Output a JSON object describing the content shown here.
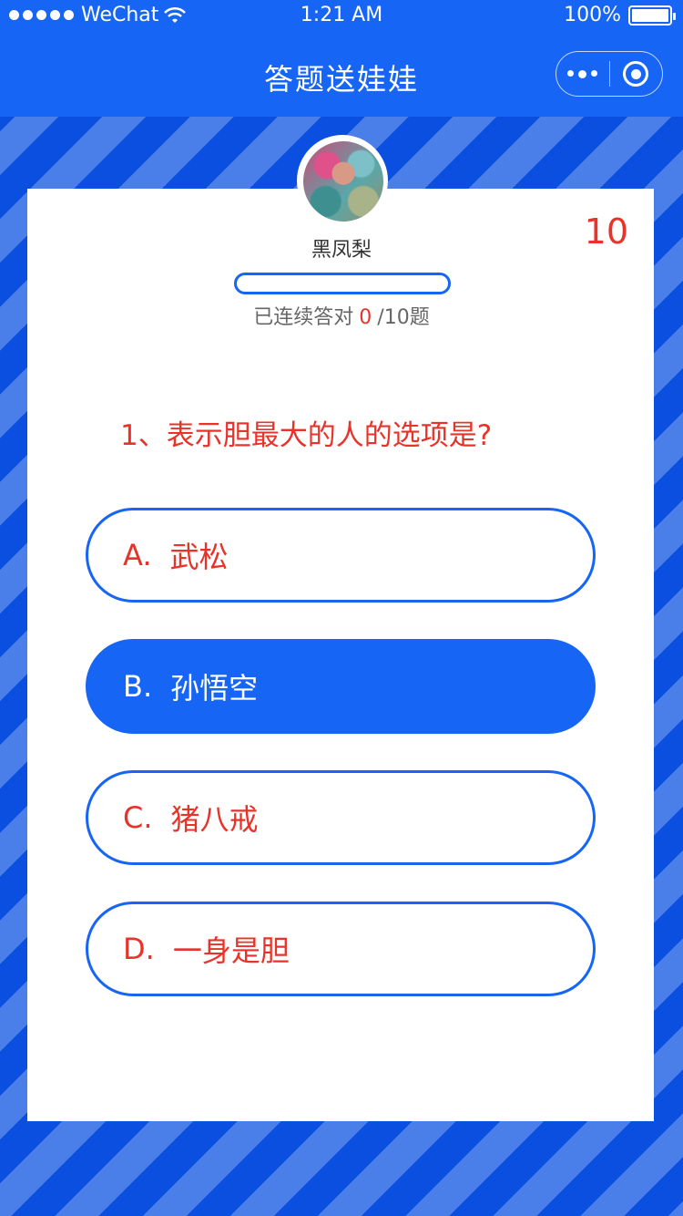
{
  "status_bar": {
    "carrier": "WeChat",
    "time": "1:21 AM",
    "battery": "100%"
  },
  "nav": {
    "title": "答题送娃娃",
    "more_icon": "more-dots-icon",
    "close_icon": "target-close-icon"
  },
  "user": {
    "name": "黑凤梨"
  },
  "timer": "10",
  "progress": {
    "label_before": "已连续答对",
    "correct": "0",
    "label_after": "/10题",
    "fraction": 0
  },
  "question": {
    "text": "1、表示胆最大的人的选项是?"
  },
  "options": [
    {
      "letter": "A.",
      "text": "武松",
      "selected": false
    },
    {
      "letter": "B.",
      "text": "孙悟空",
      "selected": true
    },
    {
      "letter": "C.",
      "text": "猪八戒",
      "selected": false
    },
    {
      "letter": "D.",
      "text": "一身是胆",
      "selected": false
    }
  ],
  "colors": {
    "primary": "#1665f5",
    "accent": "#e8332a"
  }
}
